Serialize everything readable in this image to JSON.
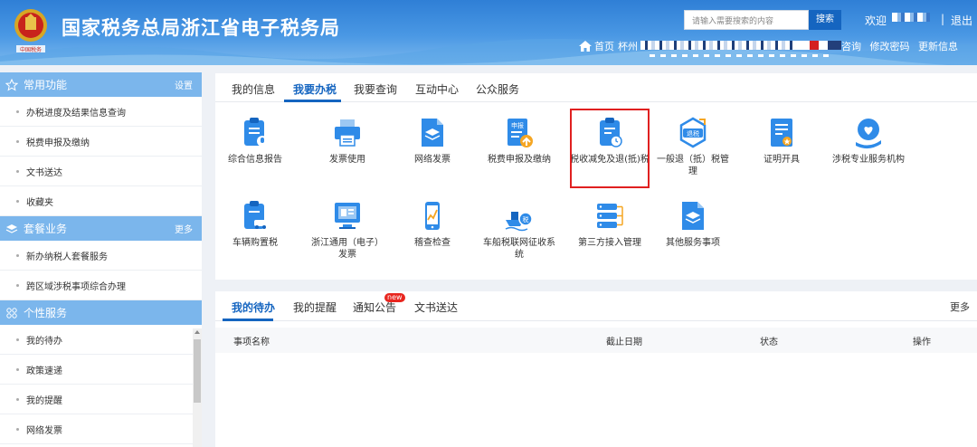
{
  "header": {
    "title": "国家税务总局浙江省电子税务局",
    "emblem_text": "中国税务",
    "search_placeholder": "请输入需要搜索的内容",
    "search_button": "搜索",
    "welcome": "欢迎",
    "separator": "|",
    "logout": "退出",
    "nav": {
      "home": "首页",
      "partial": "杯州",
      "tail_items": [
        "咨询",
        "修改密码",
        "更新信息"
      ]
    }
  },
  "sidebar": {
    "sections": [
      {
        "title": "常用功能",
        "action": "设置",
        "icon": "star-icon",
        "items": [
          "办税进度及结果信息查询",
          "税费申报及缴纳",
          "文书送达",
          "收藏夹"
        ]
      },
      {
        "title": "套餐业务",
        "action": "更多",
        "icon": "layers-icon",
        "items": [
          "新办纳税人套餐服务",
          "跨区域涉税事项综合办理"
        ]
      },
      {
        "title": "个性服务",
        "action": "",
        "icon": "grid-icon",
        "items": [
          "我的待办",
          "政策速递",
          "我的提醒",
          "网络发票"
        ]
      }
    ]
  },
  "services": {
    "tabs": [
      "我的信息",
      "我要办税",
      "我要查询",
      "互动中心",
      "公众服务"
    ],
    "active_tab": "我要办税",
    "items": [
      {
        "label": "综合信息报告",
        "icon": "clipboard-mic-icon"
      },
      {
        "label": "发票使用",
        "icon": "printer-icon"
      },
      {
        "label": "网络发票",
        "icon": "document-layers-icon"
      },
      {
        "label": "税费申报及缴纳",
        "icon": "declaration-upload-icon",
        "badge": "申报"
      },
      {
        "label": "税收减免及退(抵)税",
        "icon": "clipboard-clock-icon",
        "highlighted": true
      },
      {
        "label": "一般退（抵）税管理",
        "icon": "tax-refund-hexagon-icon",
        "badge": "退税"
      },
      {
        "label": "证明开具",
        "icon": "certificate-icon"
      },
      {
        "label": "涉税专业服务机构",
        "icon": "heart-hand-icon"
      },
      {
        "label": "车辆购置税",
        "icon": "clipboard-car-icon"
      },
      {
        "label": "浙江通用（电子）发票",
        "icon": "monitor-icon"
      },
      {
        "label": "稽查检查",
        "icon": "phone-chart-icon"
      },
      {
        "label": "车船税联网征收系统",
        "icon": "ship-tax-icon",
        "badge": "税"
      },
      {
        "label": "第三方接入管理",
        "icon": "server-connect-icon"
      },
      {
        "label": "其他服务事项",
        "icon": "document-layers-icon"
      }
    ]
  },
  "todo": {
    "tabs": [
      "我的待办",
      "我的提醒",
      "通知公告",
      "文书送达"
    ],
    "active_tab": "我的待办",
    "new_badge": "new",
    "more": "更多",
    "columns": [
      "事项名称",
      "截止日期",
      "状态",
      "操作"
    ]
  },
  "colors": {
    "primary": "#1565c0",
    "sidebar_header": "#7bb6ec",
    "icon_blue": "#2f8be8",
    "highlight_border": "#e02020"
  }
}
